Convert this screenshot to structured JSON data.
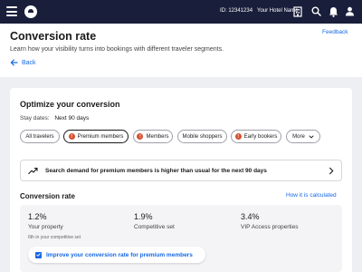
{
  "topbar": {
    "property_id": "ID: 12341234",
    "hotel_name": "Your Hotel Name",
    "icons": [
      "menu-icon",
      "logo",
      "hotel-icon",
      "search-icon",
      "bell-icon",
      "user-icon"
    ]
  },
  "header": {
    "title": "Conversion rate",
    "subtitle": "Learn how your visibility turns into bookings with different traveler segments.",
    "feedback": "Feedback",
    "back": "Back"
  },
  "optimize": {
    "title": "Optimize your conversion",
    "stay_dates_label": "Stay dates:",
    "stay_dates_value": "Next 90 days",
    "chips": [
      {
        "label": "All travelers",
        "badge": ""
      },
      {
        "label": "Premium members",
        "badge": "!"
      },
      {
        "label": "Members",
        "badge": "!"
      },
      {
        "label": "Mobile shoppers",
        "badge": ""
      },
      {
        "label": "Early bookers",
        "badge": "!"
      },
      {
        "label": "More",
        "badge": ""
      }
    ]
  },
  "insight": {
    "text": "Search demand for premium members is higher than usual for the next 90 days"
  },
  "conversion": {
    "title": "Conversion rate",
    "link": "How it is calculated",
    "stats": [
      {
        "value": "1.2%",
        "label": "Your property"
      },
      {
        "value": "1.9%",
        "label": "Competitive set"
      },
      {
        "value": "3.4%",
        "label": "VIP Access properties"
      }
    ],
    "rank_note": "6th in your competitive set",
    "improve_button": "Improve your conversion rate for premium members"
  },
  "colors": {
    "topbar": "#191e3b",
    "link": "#1668e3",
    "badge": "#d3502f",
    "background": "#eeeff2"
  }
}
